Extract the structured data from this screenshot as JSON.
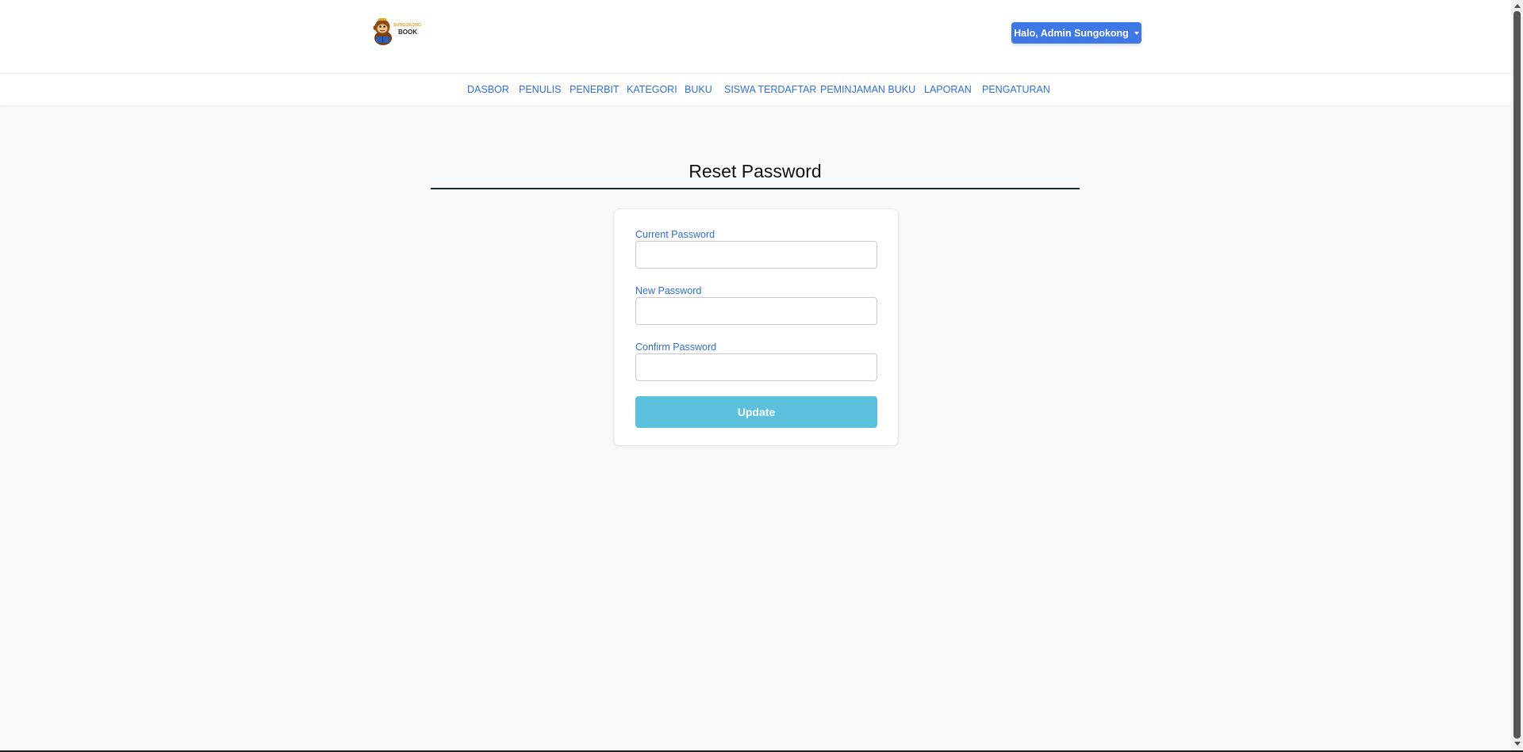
{
  "brand": {
    "logo_top": "SUNGOKONG",
    "logo_bottom": "BOOK"
  },
  "header": {
    "user_menu_label": "Halo, Admin Sungokong"
  },
  "nav": {
    "items": [
      {
        "label": "DASBOR"
      },
      {
        "label": "PENULIS"
      },
      {
        "label": "PENERBIT"
      },
      {
        "label": "KATEGORI"
      },
      {
        "label": "BUKU"
      },
      {
        "label": "SISWA TERDAFTAR"
      },
      {
        "label": "PEMINJAMAN BUKU"
      },
      {
        "label": "LAPORAN"
      },
      {
        "label": "PENGATURAN"
      }
    ]
  },
  "page": {
    "title": "Reset Password"
  },
  "form": {
    "current_password": {
      "label": "Current Password",
      "value": ""
    },
    "new_password": {
      "label": "New Password",
      "value": ""
    },
    "confirm_password": {
      "label": "Confirm Password",
      "value": ""
    },
    "submit_label": "Update"
  },
  "colors": {
    "accent": "#3f78e5",
    "nav_link": "#2f6fd6",
    "update_button": "#5bc0de",
    "title_rule": "#1b2636",
    "page_background": "#f8f9fb"
  },
  "icons": {
    "logo": "monkey-reading-book-logo",
    "dropdown": "caret-down-icon"
  }
}
